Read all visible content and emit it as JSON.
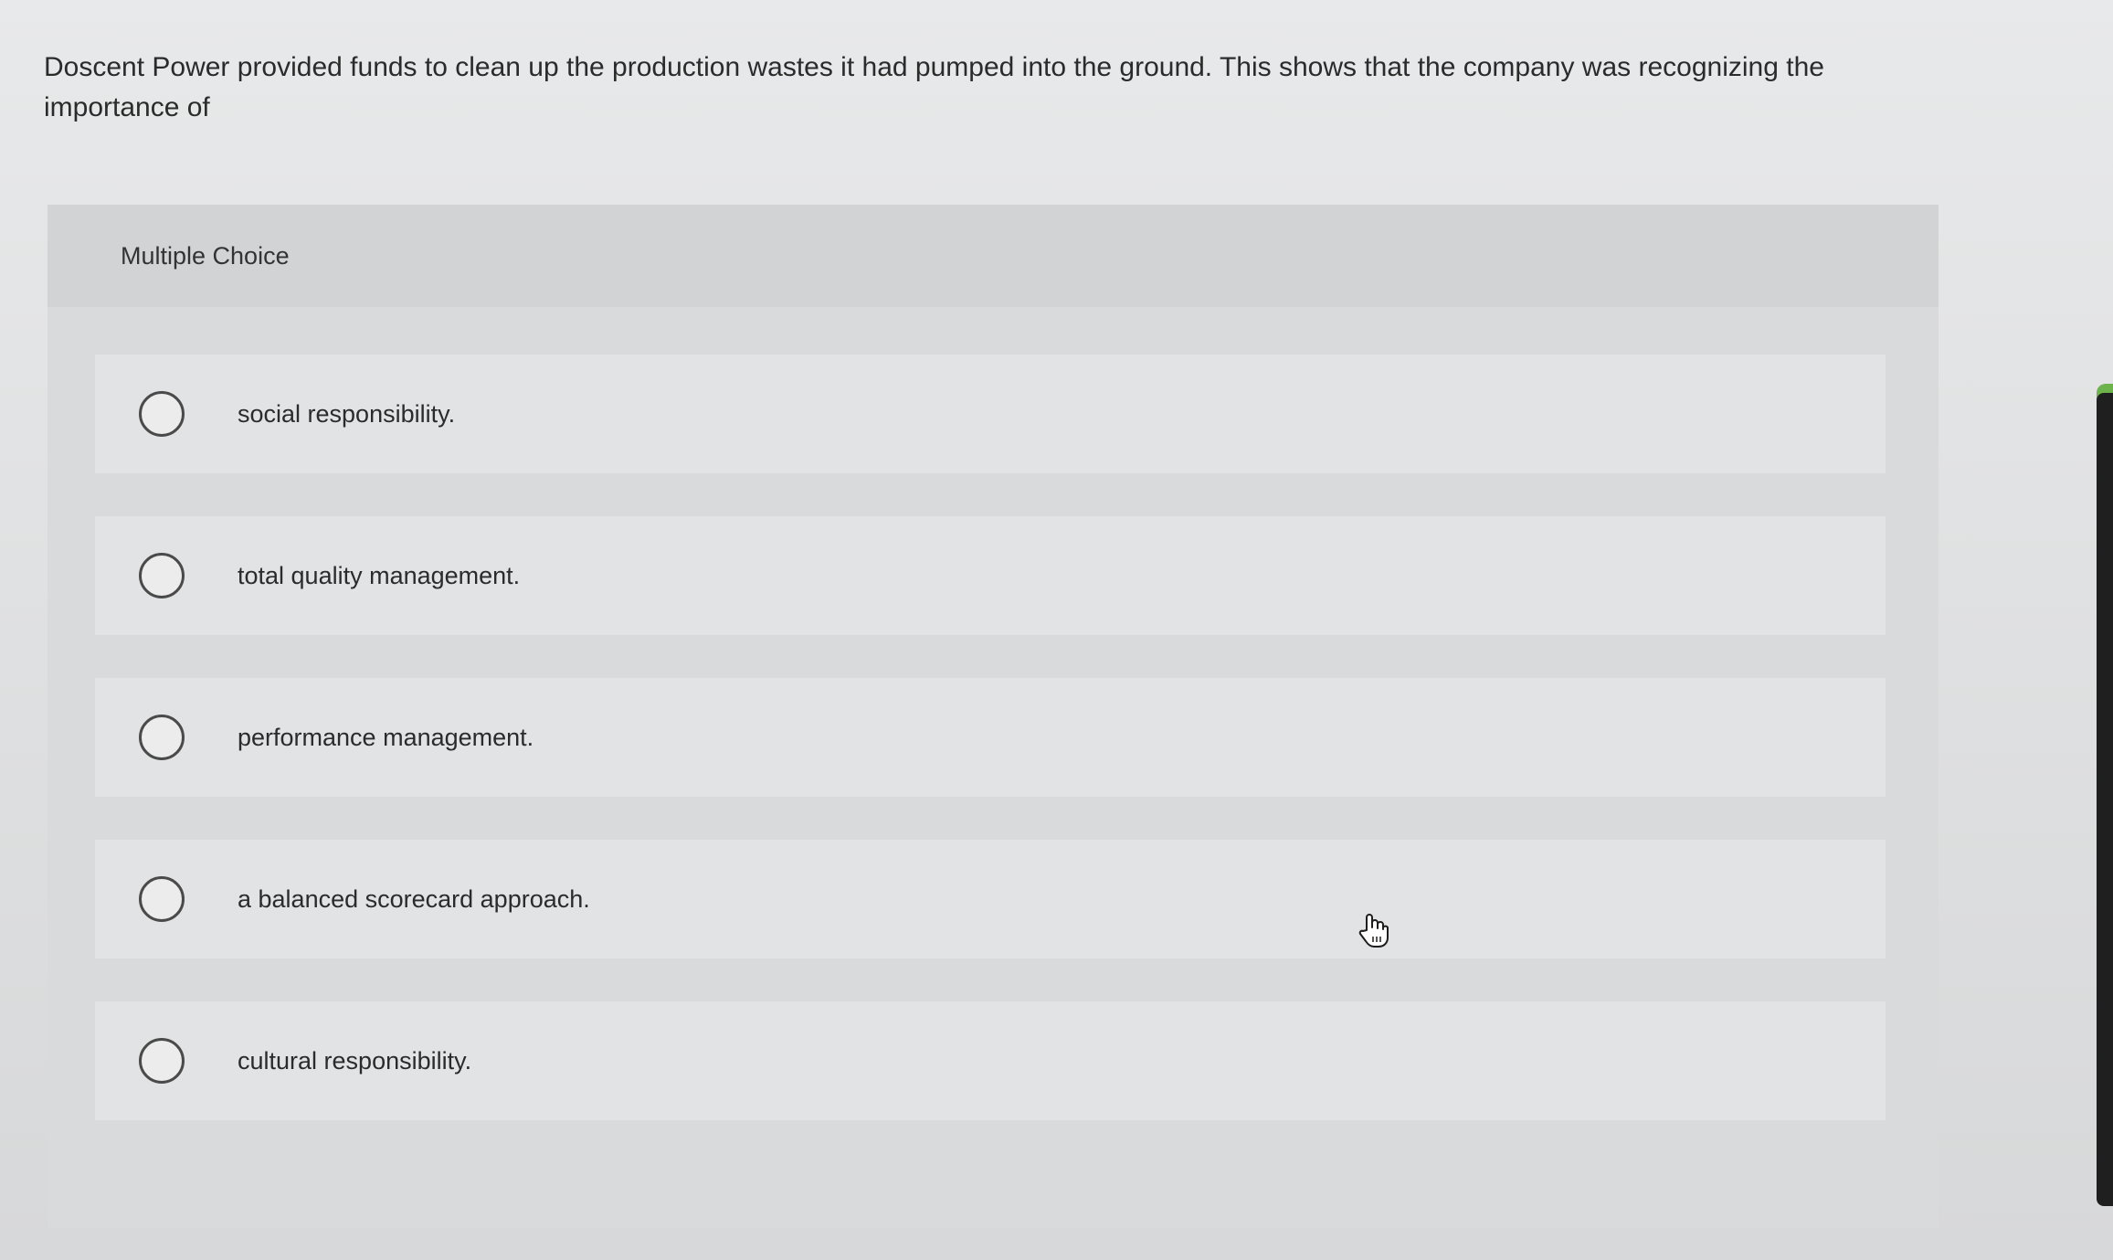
{
  "question": {
    "text": "Doscent Power provided funds to clean up the production wastes it had pumped into the ground. This shows that the company was recognizing the importance of"
  },
  "panel": {
    "header": "Multiple Choice"
  },
  "choices": [
    {
      "label": "social responsibility.",
      "selected": false
    },
    {
      "label": "total quality management.",
      "selected": false
    },
    {
      "label": "performance management.",
      "selected": false
    },
    {
      "label": "a balanced scorecard approach.",
      "selected": false
    },
    {
      "label": "cultural responsibility.",
      "selected": false
    }
  ],
  "icons": {
    "cursor": "hand-pointer-icon",
    "radio": "radio-unchecked-icon"
  },
  "colors": {
    "accent": "#6bb34a",
    "scrollbar": "#1f1f1f"
  }
}
